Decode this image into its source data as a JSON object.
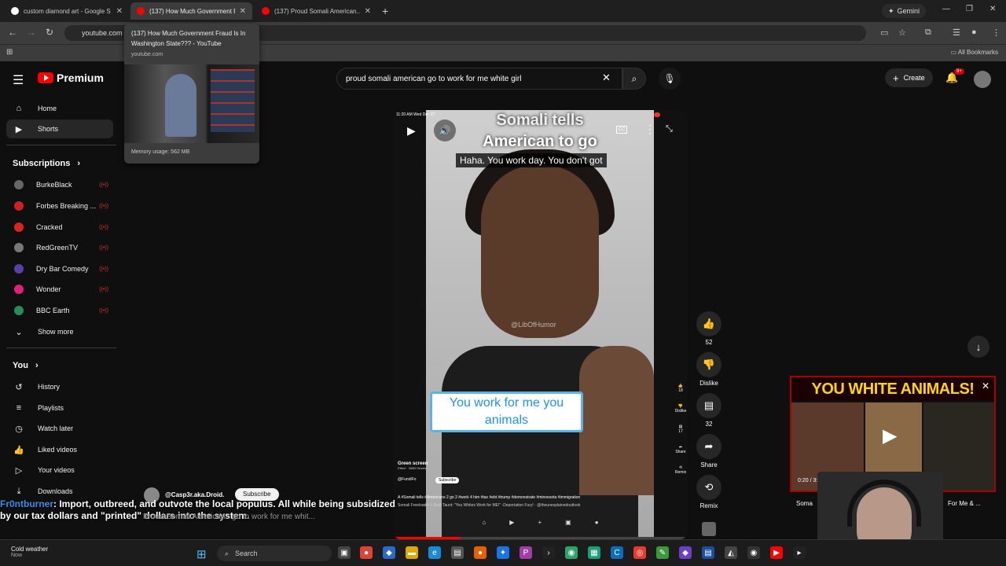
{
  "browser": {
    "tabs": [
      {
        "title": "custom diamond art - Google S",
        "favicon_color": "#ffffff"
      },
      {
        "title": "(137) How Much Government F",
        "favicon_color": "#ff0000"
      },
      {
        "title": "(137) Proud Somali American...",
        "favicon_color": "#ff0000"
      }
    ],
    "gemini_label": "Gemini",
    "url": "youtube.com",
    "all_bookmarks": "All Bookmarks"
  },
  "hover_card": {
    "title": "(137) How Much Government Fraud Is In Washington State??? - YouTube",
    "url": "youtube.com",
    "memory": "Memory usage: 562 MB"
  },
  "youtube": {
    "logo_text": "Premium",
    "search_query": "proud somali american go to work for me white girl",
    "create_label": "Create",
    "notif_badge": "9+",
    "nav": [
      {
        "label": "Home",
        "icon": "home-icon"
      },
      {
        "label": "Shorts",
        "icon": "shorts-icon"
      }
    ],
    "subscriptions_heading": "Subscriptions",
    "subscriptions": [
      {
        "name": "BurkeBlack",
        "color": "#666666"
      },
      {
        "name": "Forbes Breaking ...",
        "color": "#cc2222"
      },
      {
        "name": "Cracked",
        "color": "#dd2222"
      },
      {
        "name": "RedGreenTV",
        "color": "#777777"
      },
      {
        "name": "Dry Bar Comedy",
        "color": "#5a3fa8"
      },
      {
        "name": "Wonder",
        "color": "#e0207a"
      },
      {
        "name": "BBC Earth",
        "color": "#2a8a5a"
      }
    ],
    "show_more": "Show more",
    "you_heading": "You",
    "you_items": [
      {
        "label": "History",
        "icon": "history-icon"
      },
      {
        "label": "Playlists",
        "icon": "playlists-icon"
      },
      {
        "label": "Watch later",
        "icon": "watch-later-icon"
      },
      {
        "label": "Liked videos",
        "icon": "liked-icon"
      },
      {
        "label": "Your videos",
        "icon": "your-videos-icon"
      },
      {
        "label": "Downloads",
        "icon": "downloads-icon"
      }
    ]
  },
  "short": {
    "title_line1": "Somali tells",
    "title_line2": "American to go",
    "caption": "Haha. You work day. You don't got",
    "watermark": "@LibOfHumor",
    "subtitle": "You work for me you animals",
    "status_time": "11:20 AM  Wed Dec 17",
    "green_screen": "Green screen",
    "green_screen_sub": "Effect · 265M Shorts",
    "channel": "@FundiFo",
    "subscribe": "Subscribe",
    "tags": "A #Somali tells #Americans 2 go 2 #work 4 him #tax #ebt #trump #demonstrate #minnesota #immigration",
    "sub2": "Somali Freeloader's Bold Taunt: \"You Whites Work for ME!\" -Deportation Fury! · @theunexplainedoutlook",
    "inner_likes": "18",
    "inner_dislike": "Dislike",
    "inner_comments": "17",
    "inner_share": "Share",
    "inner_remix": "Remix",
    "progress": 0.23
  },
  "actions": {
    "likes": "52",
    "dislike_label": "Dislike",
    "comments": "32",
    "share_label": "Share",
    "remix_label": "Remix"
  },
  "mini_player": {
    "banner": "YOU WHITE ANIMALS!",
    "time": "0:20 / 3:34",
    "title_left": "Soma",
    "title_right": "For Me & ..."
  },
  "overlay": {
    "chat_user": "@Casp3r.aka.Droid.",
    "chat_subscribe": "Subscribe",
    "ticker_name": "Fr0ntburner",
    "ticker_text": ": Import, outbreed, and outvote the local populus. All while being subsidized by our tax dollars and \"printed\" dollars into the system.",
    "ghost_text": "Proud Somali American.. go to work for me whit..."
  },
  "taskbar": {
    "weather": "Cold weather",
    "weather_sub": "Now",
    "search": "Search"
  }
}
